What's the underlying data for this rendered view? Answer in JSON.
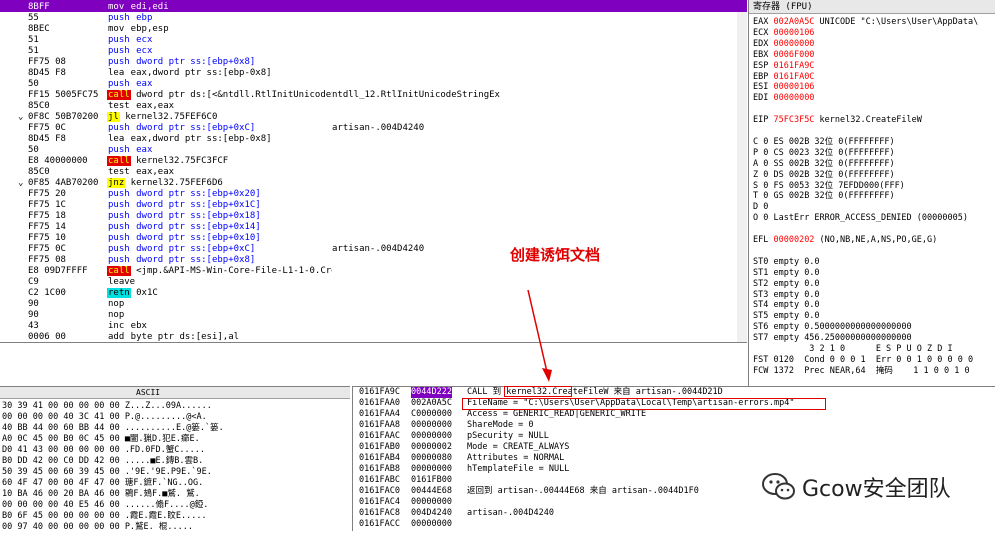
{
  "disasm": {
    "rows": [
      {
        "mark": "",
        "bytes": "8BFF",
        "instr": "mov edi,edi",
        "kind": "plain",
        "cmt": ""
      },
      {
        "mark": "",
        "bytes": "55",
        "instr": "push ebp",
        "kind": "blue",
        "cmt": ""
      },
      {
        "mark": "",
        "bytes": "8BEC",
        "instr": "mov ebp,esp",
        "kind": "plain",
        "cmt": ""
      },
      {
        "mark": "",
        "bytes": "51",
        "instr": "push ecx",
        "kind": "blue",
        "cmt": ""
      },
      {
        "mark": "",
        "bytes": "51",
        "instr": "push ecx",
        "kind": "blue",
        "cmt": ""
      },
      {
        "mark": "",
        "bytes": "FF75 08",
        "instr": "push dword ptr ss:[ebp+0x8]",
        "kind": "blue",
        "cmt": ""
      },
      {
        "mark": "",
        "bytes": "8D45 F8",
        "instr": "lea eax,dword ptr ss:[ebp-0x8]",
        "kind": "plain",
        "cmt": ""
      },
      {
        "mark": "",
        "bytes": "50",
        "instr": "push eax",
        "kind": "blue",
        "cmt": ""
      },
      {
        "mark": "",
        "bytes": "FF15 5005FC75",
        "instr": "call dword ptr ds:[<&ntdll.RtlInitUnicodeString>]",
        "kind": "call",
        "cmt": "ntdll_12.RtlInitUnicodeStringEx"
      },
      {
        "mark": "",
        "bytes": "85C0",
        "instr": "test eax,eax",
        "kind": "plain",
        "cmt": ""
      },
      {
        "mark": "⌄",
        "bytes": "0F8C 50B70200",
        "instr": "jl kernel32.75FEF6C0",
        "kind": "jmp",
        "cmt": ""
      },
      {
        "mark": "",
        "bytes": "FF75 0C",
        "instr": "push dword ptr ss:[ebp+0xC]",
        "kind": "blue",
        "cmt": "artisan-.004D4240"
      },
      {
        "mark": "",
        "bytes": "8D45 F8",
        "instr": "lea eax,dword ptr ss:[ebp-0x8]",
        "kind": "plain",
        "cmt": ""
      },
      {
        "mark": "",
        "bytes": "50",
        "instr": "push eax",
        "kind": "blue",
        "cmt": ""
      },
      {
        "mark": "",
        "bytes": "E8 40000000",
        "instr": "call kernel32.75FC3FCF",
        "kind": "call",
        "cmt": ""
      },
      {
        "mark": "",
        "bytes": "85C0",
        "instr": "test eax,eax",
        "kind": "plain",
        "cmt": ""
      },
      {
        "mark": "⌄",
        "bytes": "0F85 4AB70200",
        "instr": "jnz kernel32.75FEF6D6",
        "kind": "jmp",
        "cmt": ""
      },
      {
        "mark": "",
        "bytes": "FF75 20",
        "instr": "push dword ptr ss:[ebp+0x20]",
        "kind": "blue",
        "cmt": ""
      },
      {
        "mark": "",
        "bytes": "FF75 1C",
        "instr": "push dword ptr ss:[ebp+0x1C]",
        "kind": "blue",
        "cmt": ""
      },
      {
        "mark": "",
        "bytes": "FF75 18",
        "instr": "push dword ptr ss:[ebp+0x18]",
        "kind": "blue",
        "cmt": ""
      },
      {
        "mark": "",
        "bytes": "FF75 14",
        "instr": "push dword ptr ss:[ebp+0x14]",
        "kind": "blue",
        "cmt": ""
      },
      {
        "mark": "",
        "bytes": "FF75 10",
        "instr": "push dword ptr ss:[ebp+0x10]",
        "kind": "blue",
        "cmt": ""
      },
      {
        "mark": "",
        "bytes": "FF75 0C",
        "instr": "push dword ptr ss:[ebp+0xC]",
        "kind": "blue",
        "cmt": "artisan-.004D4240"
      },
      {
        "mark": "",
        "bytes": "FF75 08",
        "instr": "push dword ptr ss:[ebp+0x8]",
        "kind": "blue",
        "cmt": ""
      },
      {
        "mark": "",
        "bytes": "E8 09D7FFFF",
        "instr": "call <jmp.&API-MS-Win-Core-File-L1-1-0.CreateFileW>",
        "kind": "call",
        "cmt": ""
      },
      {
        "mark": "",
        "bytes": "C9",
        "instr": "leave",
        "kind": "plain",
        "cmt": ""
      },
      {
        "mark": "",
        "bytes": "C2 1C00",
        "instr": "retn 0x1C",
        "kind": "ret",
        "cmt": ""
      },
      {
        "mark": "",
        "bytes": "90",
        "instr": "nop",
        "kind": "plain",
        "cmt": ""
      },
      {
        "mark": "",
        "bytes": "90",
        "instr": "nop",
        "kind": "plain",
        "cmt": ""
      },
      {
        "mark": "",
        "bytes": "43",
        "instr": "inc ebx",
        "kind": "plain",
        "cmt": ""
      },
      {
        "mark": "",
        "bytes": "0006 00",
        "instr": "add byte ptr ds:[esi],al",
        "kind": "plain",
        "cmt": ""
      }
    ]
  },
  "registers": {
    "title": "寄存器 (FPU)",
    "lines": [
      {
        "name": "EAX",
        "val": "002A0A5C",
        "rest": "UNICODE \"C:\\Users\\User\\AppData\\",
        "red": true
      },
      {
        "name": "ECX",
        "val": "00000106",
        "rest": "",
        "red": true
      },
      {
        "name": "EDX",
        "val": "00000000",
        "rest": "",
        "red": true
      },
      {
        "name": "EBX",
        "val": "0006F000",
        "rest": "",
        "red": true
      },
      {
        "name": "ESP",
        "val": "0161FA9C",
        "rest": "",
        "red": true
      },
      {
        "name": "EBP",
        "val": "0161FA0C",
        "rest": "",
        "red": true
      },
      {
        "name": "ESI",
        "val": "00000106",
        "rest": "",
        "red": true
      },
      {
        "name": "EDI",
        "val": "00000000",
        "rest": "",
        "red": true
      },
      {
        "name": "",
        "val": "",
        "rest": "",
        "red": false
      },
      {
        "name": "EIP",
        "val": "75FC3F5C",
        "rest": "kernel32.CreateFileW",
        "red": true
      },
      {
        "name": "",
        "val": "",
        "rest": "",
        "red": false
      },
      {
        "name": "C 0",
        "val": "",
        "rest": "ES 002B 32位 0(FFFFFFFF)",
        "red": false
      },
      {
        "name": "P 0",
        "val": "",
        "rest": "CS 0023 32位 0(FFFFFFFF)",
        "red": false
      },
      {
        "name": "A 0",
        "val": "",
        "rest": "SS 002B 32位 0(FFFFFFFF)",
        "red": false
      },
      {
        "name": "Z 0",
        "val": "",
        "rest": "DS 002B 32位 0(FFFFFFFF)",
        "red": false
      },
      {
        "name": "S 0",
        "val": "",
        "rest": "FS 0053 32位 7EFDD000(FFF)",
        "red": false
      },
      {
        "name": "T 0",
        "val": "",
        "rest": "GS 002B 32位 0(FFFFFFFF)",
        "red": false
      },
      {
        "name": "D 0",
        "val": "",
        "rest": "",
        "red": false
      },
      {
        "name": "O 0",
        "val": "",
        "rest": "LastErr ERROR_ACCESS_DENIED (00000005)",
        "red": false
      },
      {
        "name": "",
        "val": "",
        "rest": "",
        "red": false
      },
      {
        "name": "EFL",
        "val": "00000202",
        "rest": "(NO,NB,NE,A,NS,PO,GE,G)",
        "red": true
      },
      {
        "name": "",
        "val": "",
        "rest": "",
        "red": false
      },
      {
        "name": "ST0",
        "val": "",
        "rest": "empty 0.0",
        "red": false
      },
      {
        "name": "ST1",
        "val": "",
        "rest": "empty 0.0",
        "red": false
      },
      {
        "name": "ST2",
        "val": "",
        "rest": "empty 0.0",
        "red": false
      },
      {
        "name": "ST3",
        "val": "",
        "rest": "empty 0.0",
        "red": false
      },
      {
        "name": "ST4",
        "val": "",
        "rest": "empty 0.0",
        "red": false
      },
      {
        "name": "ST5",
        "val": "",
        "rest": "empty 0.0",
        "red": false
      },
      {
        "name": "ST6",
        "val": "",
        "rest": "empty 0.5000000000000000000",
        "red": false
      },
      {
        "name": "ST7",
        "val": "",
        "rest": "empty 456.25000000000000000",
        "red": false
      },
      {
        "name": "",
        "val": "",
        "rest": "           3 2 1 0      E S P U O Z D I",
        "red": false
      },
      {
        "name": "FST",
        "val": "",
        "rest": "0120  Cond 0 0 0 1  Err 0 0 1 0 0 0 0 0",
        "red": false
      },
      {
        "name": "FCW",
        "val": "",
        "rest": "1372  Prec NEAR,64  掩码    1 1 0 0 1 0",
        "red": false
      }
    ]
  },
  "dump": {
    "header": "ASCII",
    "rows": [
      "30 39 41 00 00 00 00 00 Z...Z...09A......",
      "00 00 00 00 40 3C 41 00 P.@.........@<A.",
      "40 BB 44 00 60 BB 44 00 ..........E.@篓.`篓.",
      "A0 0C 45 00 B0 0C 45 00 ■闔.猟D.犯E.癤E.",
      "D0 41 43 00 00 00 00 00 .FD.0FD.蟹C.....",
      "B0 DD 42 00 C0 DD 42 00 .....■E.鏄B.雲B.",
      "50 39 45 00 60 39 45 00 .'9E.'9E.P9E.`9E.",
      "60 4F 47 00 00 4F 47 00 瑭F.鏣F.`NG..OG.",
      "10 BA 46 00 20 BA 46 00 鶍F.鳷F.■鷲. 鷲.",
      "00 00 00 00 40 E5 46 00 ......翛F....@錏.",
      "B0 6F 45 00 00 00 00 00 .霞E.霞E.盿E.....",
      "00 97 40 00 00 00 00 00 P.鷲E. 棍....."
    ]
  },
  "stack": {
    "rows": [
      {
        "a": "0161FA9C",
        "v": "0044D222",
        "c": "CALL 到 kernel32.CreateFileW 来自 artisan-.0044D21D",
        "sel": true
      },
      {
        "a": "0161FAA0",
        "v": "002A0A5C",
        "c": "FileName = \"C:\\Users\\User\\AppData\\Local\\Temp\\artisan-errors.mp4\"",
        "sel": false
      },
      {
        "a": "0161FAA4",
        "v": "C0000000",
        "c": "Access = GENERIC_READ|GENERIC_WRITE",
        "sel": false
      },
      {
        "a": "0161FAA8",
        "v": "00000000",
        "c": "ShareMode = 0",
        "sel": false
      },
      {
        "a": "0161FAAC",
        "v": "00000000",
        "c": "pSecurity = NULL",
        "sel": false
      },
      {
        "a": "0161FAB0",
        "v": "00000002",
        "c": "Mode = CREATE_ALWAYS",
        "sel": false
      },
      {
        "a": "0161FAB4",
        "v": "00000080",
        "c": "Attributes = NORMAL",
        "sel": false
      },
      {
        "a": "0161FAB8",
        "v": "00000000",
        "c": "hTemplateFile = NULL",
        "sel": false
      },
      {
        "a": "0161FABC",
        "v": "0161FB00",
        "c": "",
        "sel": false
      },
      {
        "a": "0161FAC0",
        "v": "00444E68",
        "c": "返回到 artisan-.00444E68 来自 artisan-.0044D1F0",
        "sel": false
      },
      {
        "a": "0161FAC4",
        "v": "00000000",
        "c": "",
        "sel": false
      },
      {
        "a": "0161FAC8",
        "v": "004D4240",
        "c": "artisan-.004D4240",
        "sel": false
      },
      {
        "a": "0161FACC",
        "v": "00000000",
        "c": "",
        "sel": false
      }
    ]
  },
  "annotation": {
    "text": "创建诱饵文档"
  },
  "watermark": {
    "label": "Gcow安全团队",
    "icon": "wechat-icon"
  },
  "colors": {
    "header_purple": "#8000c0",
    "annotation_red": "#e00000",
    "call_red": "#e00000",
    "jmp_yellow": "#ffff00"
  }
}
